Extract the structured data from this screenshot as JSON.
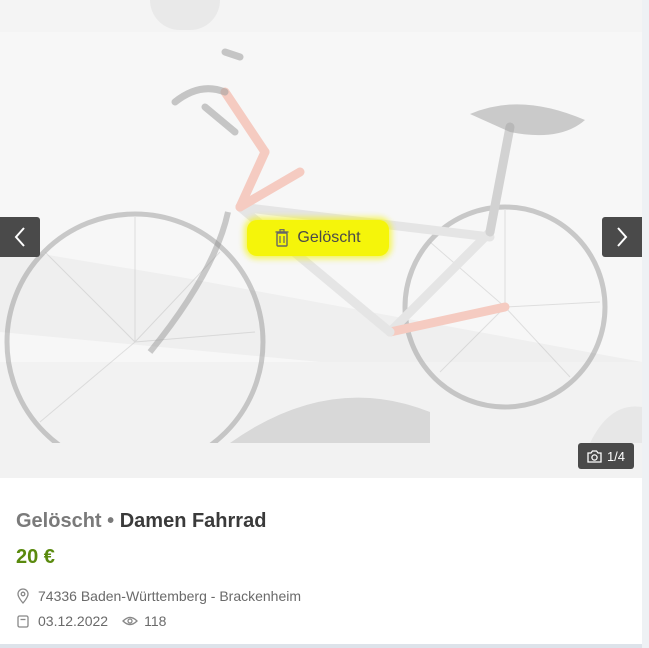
{
  "gallery": {
    "deleted_label": "Gelöscht",
    "counter": "1/4",
    "icons": {
      "prev": "chevron-left-icon",
      "next": "chevron-right-icon",
      "trash": "trash-icon",
      "camera": "camera-icon"
    },
    "badge_color": "#f5f50a"
  },
  "listing": {
    "state": "Gelöscht",
    "separator": "•",
    "title": "Damen Fahrrad",
    "price": "20 €",
    "location": "74336 Baden-Württemberg - Brackenheim",
    "date": "03.12.2022",
    "views": "118",
    "icons": {
      "location": "map-pin-icon",
      "date": "calendar-icon",
      "views": "eye-icon"
    },
    "price_color": "#5a8a0e"
  }
}
